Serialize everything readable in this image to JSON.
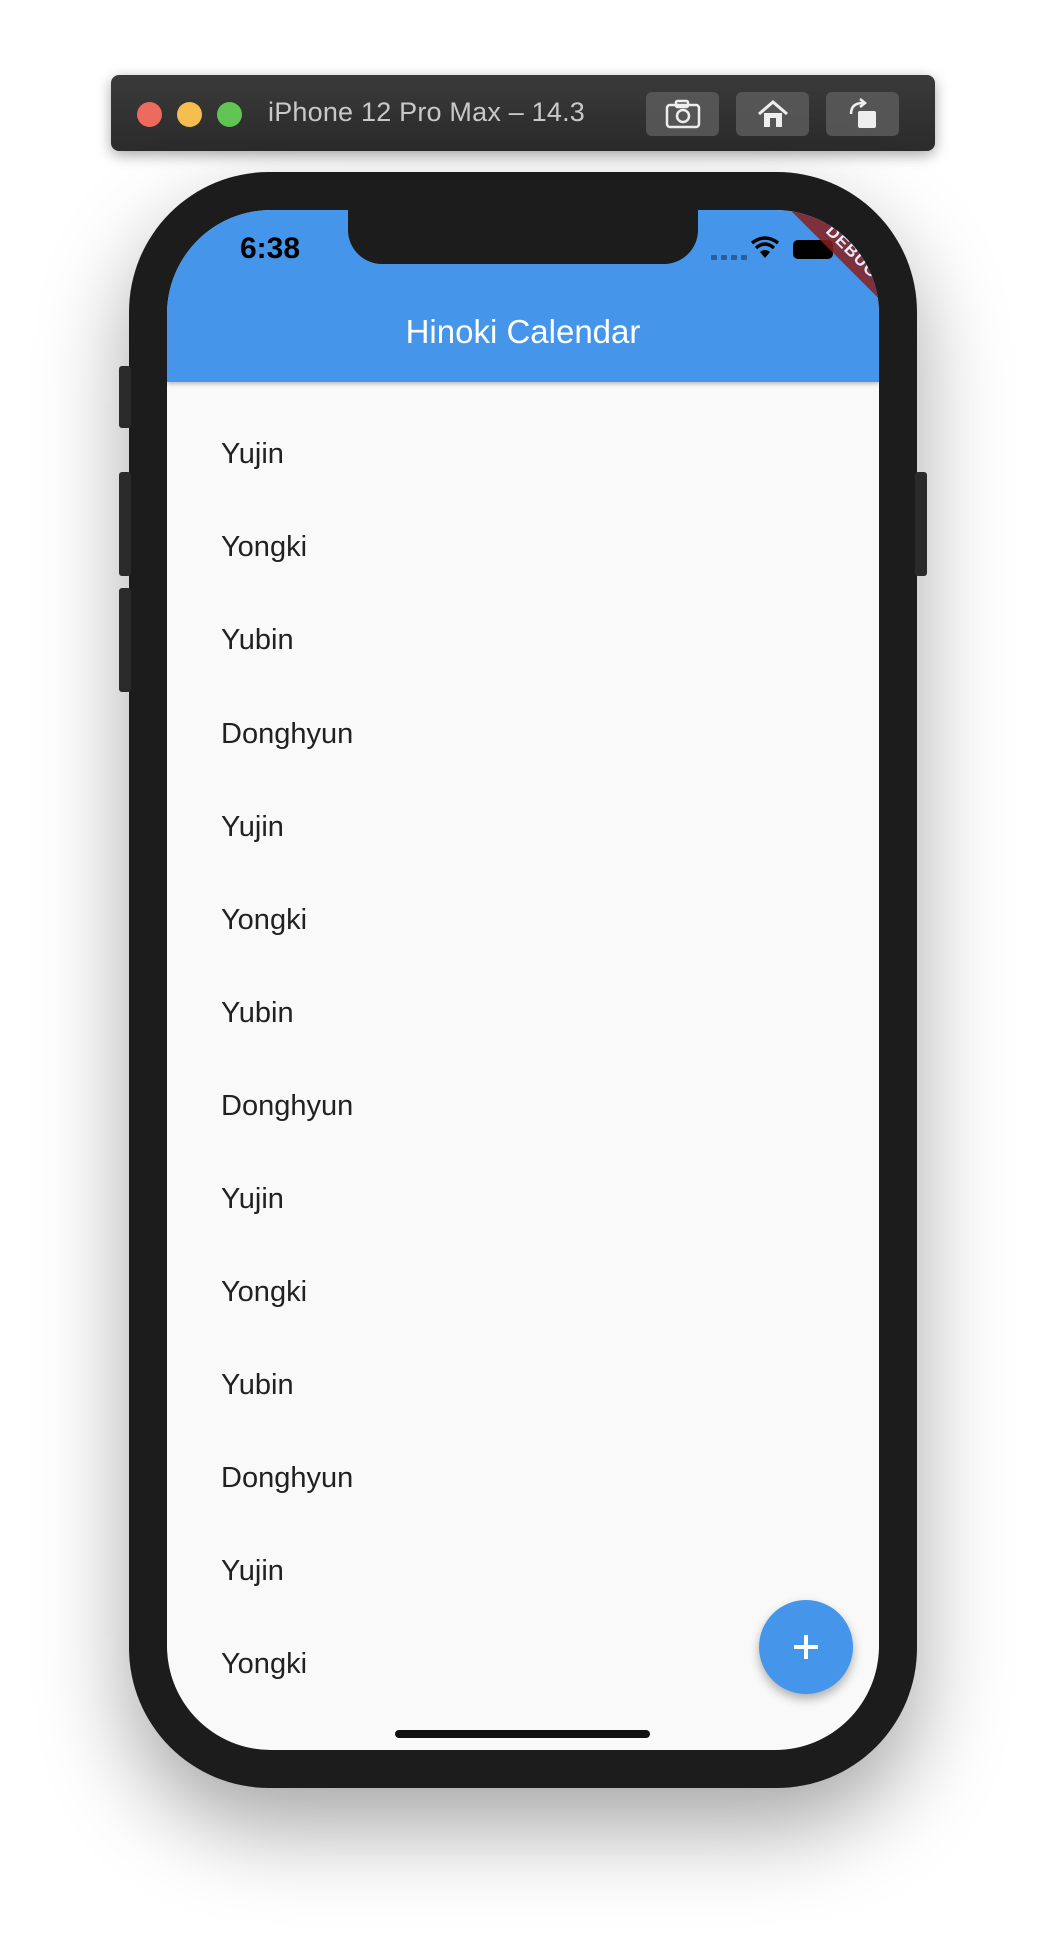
{
  "simulator": {
    "title": "iPhone 12 Pro Max – 14.3",
    "buttons": [
      {
        "name": "screenshot",
        "icon": "camera-icon"
      },
      {
        "name": "home",
        "icon": "home-icon"
      },
      {
        "name": "rotate",
        "icon": "rotate-icon"
      }
    ]
  },
  "status_bar": {
    "time": "6:38",
    "debug_banner": "DEBUG"
  },
  "appbar": {
    "title": "Hinoki Calendar"
  },
  "list": {
    "items": [
      "Yujin",
      "Yongki",
      "Yubin",
      "Donghyun",
      "Yujin",
      "Yongki",
      "Yubin",
      "Donghyun",
      "Yujin",
      "Yongki",
      "Yubin",
      "Donghyun",
      "Yujin",
      "Yongki"
    ]
  },
  "fab": {
    "icon": "plus-icon"
  },
  "colors": {
    "appbar": "#4596ea",
    "fab": "#4596ea",
    "screen_background": "#f9f9f9",
    "phone_frame": "#1c1c1c",
    "debug_banner": "#8a1f1f"
  }
}
